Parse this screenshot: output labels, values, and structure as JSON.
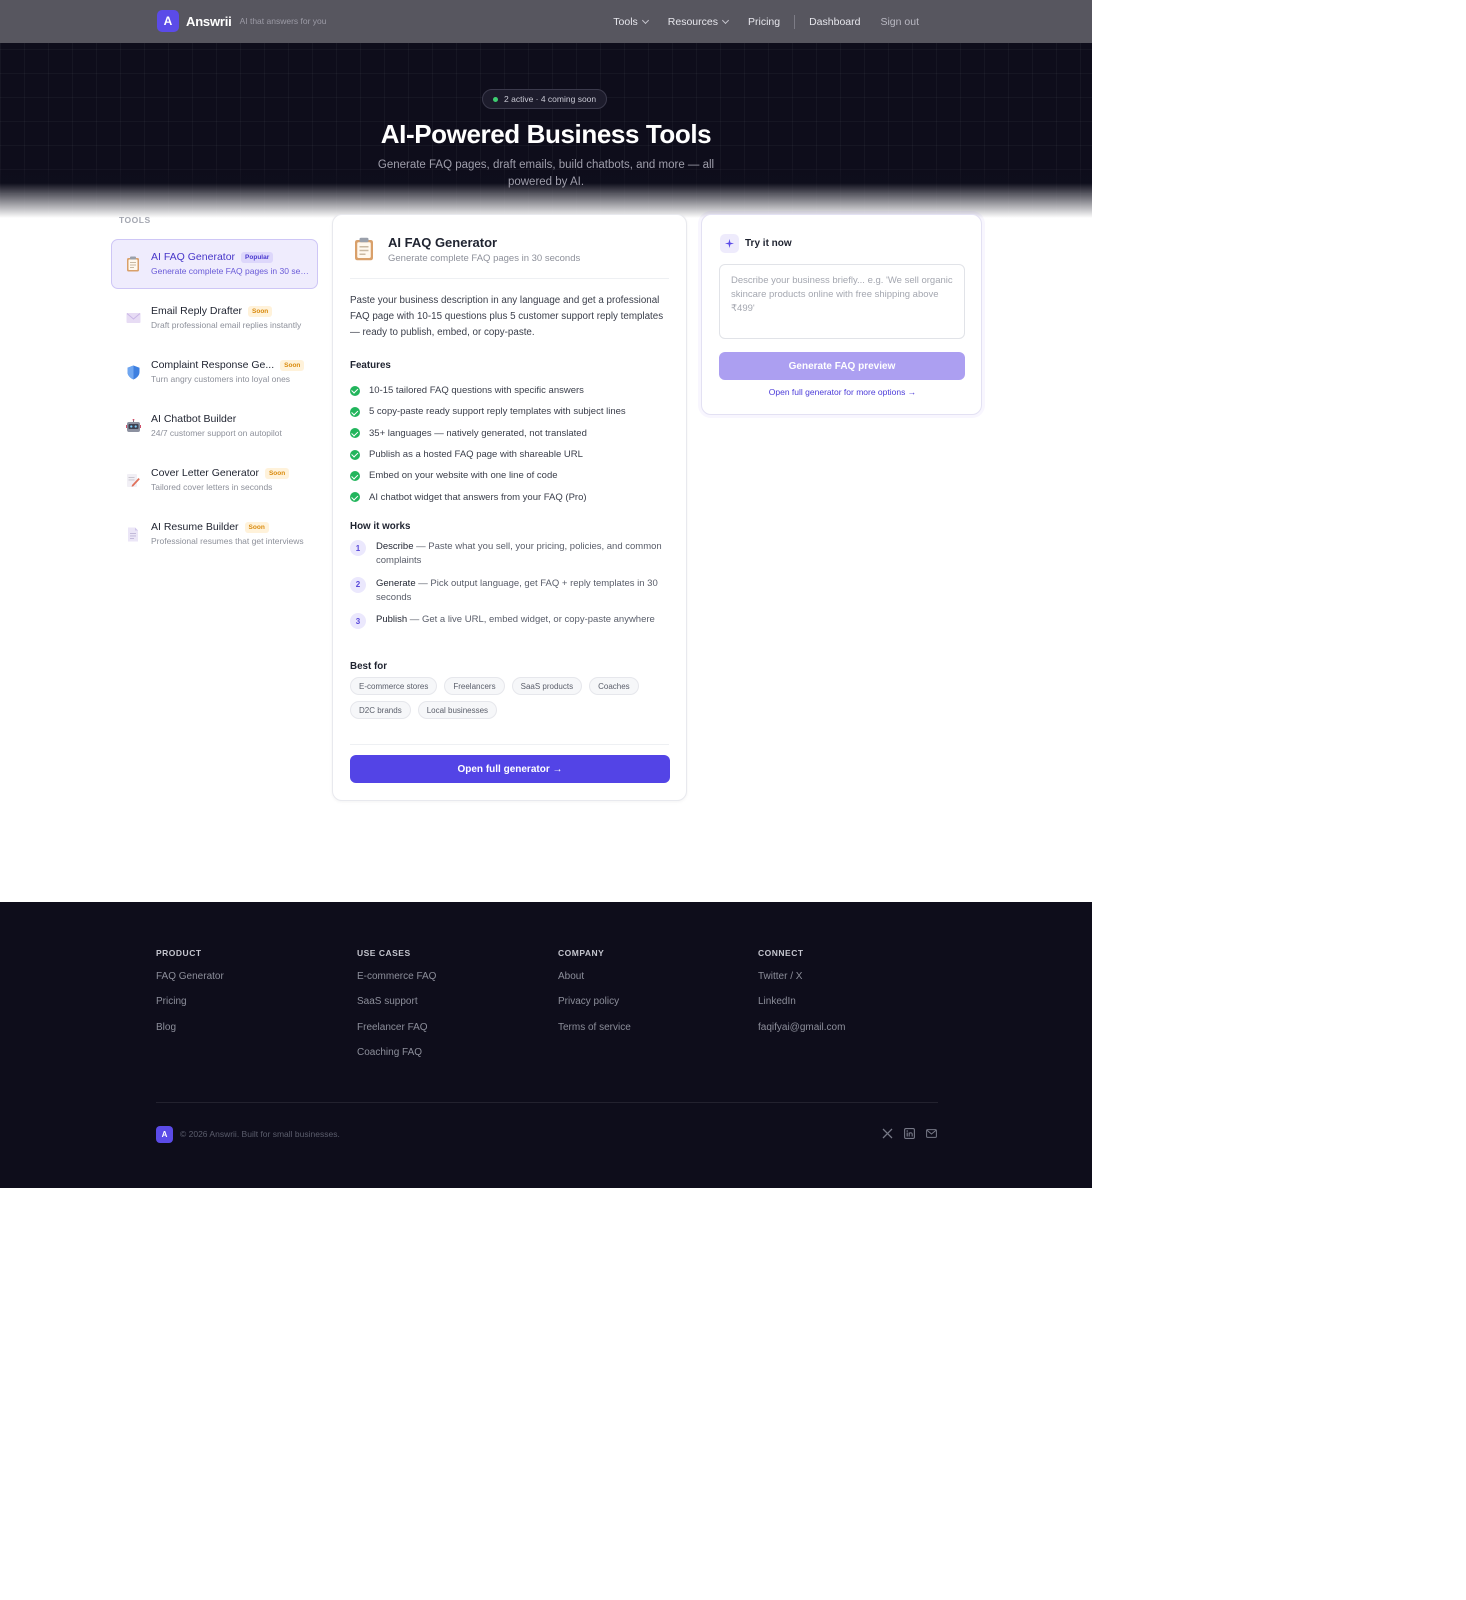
{
  "brand": {
    "mark": "A",
    "name": "Answrii",
    "tagline": "AI that answers for you"
  },
  "nav": {
    "tools": "Tools",
    "resources": "Resources",
    "pricing": "Pricing",
    "dashboard": "Dashboard",
    "signout": "Sign out"
  },
  "hero": {
    "pill": "2 active · 4 coming soon",
    "title": "AI-Powered Business Tools",
    "subtitle": "Generate FAQ pages, draft emails, build chatbots, and more — all powered by AI."
  },
  "sidebar": {
    "label": "TOOLS",
    "items": [
      {
        "title": "AI FAQ Generator",
        "badge": "Popular",
        "desc": "Generate complete FAQ pages in 30 seconds",
        "icon": "clipboard-icon"
      },
      {
        "title": "Email Reply Drafter",
        "badge": "Soon",
        "desc": "Draft professional email replies instantly",
        "icon": "envelope-icon"
      },
      {
        "title": "Complaint Response Ge...",
        "badge": "Soon",
        "desc": "Turn angry customers into loyal ones",
        "icon": "shield-icon"
      },
      {
        "title": "AI Chatbot Builder",
        "badge": "",
        "desc": "24/7 customer support on autopilot",
        "icon": "robot-icon"
      },
      {
        "title": "Cover Letter Generator",
        "badge": "Soon",
        "desc": "Tailored cover letters in seconds",
        "icon": "memo-icon"
      },
      {
        "title": "AI Resume Builder",
        "badge": "Soon",
        "desc": "Professional resumes that get interviews",
        "icon": "page-icon"
      }
    ]
  },
  "main": {
    "title": "AI FAQ Generator",
    "subtitle": "Generate complete FAQ pages in 30 seconds",
    "description": "Paste your business description in any language and get a professional FAQ page with 10-15 questions plus 5 customer support reply templates — ready to publish, embed, or copy-paste.",
    "features_heading": "Features",
    "features": [
      "10-15 tailored FAQ questions with specific answers",
      "5 copy-paste ready support reply templates with subject lines",
      "35+ languages — natively generated, not translated",
      "Publish as a hosted FAQ page with shareable URL",
      "Embed on your website with one line of code",
      "AI chatbot widget that answers from your FAQ (Pro)"
    ],
    "how_heading": "How it works",
    "steps": [
      {
        "num": "1",
        "title": "Describe",
        "text": " — Paste what you sell, your pricing, policies, and common complaints"
      },
      {
        "num": "2",
        "title": "Generate",
        "text": " — Pick output language, get FAQ + reply templates in 30 seconds"
      },
      {
        "num": "3",
        "title": "Publish",
        "text": " — Get a live URL, embed widget, or copy-paste anywhere"
      }
    ],
    "best_heading": "Best for",
    "tags": [
      "E-commerce stores",
      "Freelancers",
      "SaaS products",
      "Coaches",
      "D2C brands",
      "Local businesses"
    ],
    "cta": "Open full generator →"
  },
  "try": {
    "title": "Try it now",
    "placeholder": "Describe your business briefly... e.g. 'We sell organic skincare products online with free shipping above ₹499'",
    "button": "Generate FAQ preview",
    "link": "Open full generator for more options →"
  },
  "footer": {
    "columns": [
      {
        "heading": "PRODUCT",
        "links": [
          "FAQ Generator",
          "Pricing",
          "Blog"
        ]
      },
      {
        "heading": "USE CASES",
        "links": [
          "E-commerce FAQ",
          "SaaS support",
          "Freelancer FAQ",
          "Coaching FAQ"
        ]
      },
      {
        "heading": "COMPANY",
        "links": [
          "About",
          "Privacy policy",
          "Terms of service"
        ]
      },
      {
        "heading": "CONNECT",
        "links": [
          "Twitter / X",
          "LinkedIn",
          "faqifyai@gmail.com"
        ]
      }
    ],
    "mark": "A",
    "copyright": "© 2026 Answrii. Built for small businesses.",
    "social_icons": [
      "x-icon",
      "linkedin-icon",
      "mail-icon"
    ]
  },
  "colors": {
    "accent": "#5344e6",
    "hero_bg": "#0e0d1b",
    "success": "#22b55c",
    "soon_badge": "#d98a0d"
  }
}
